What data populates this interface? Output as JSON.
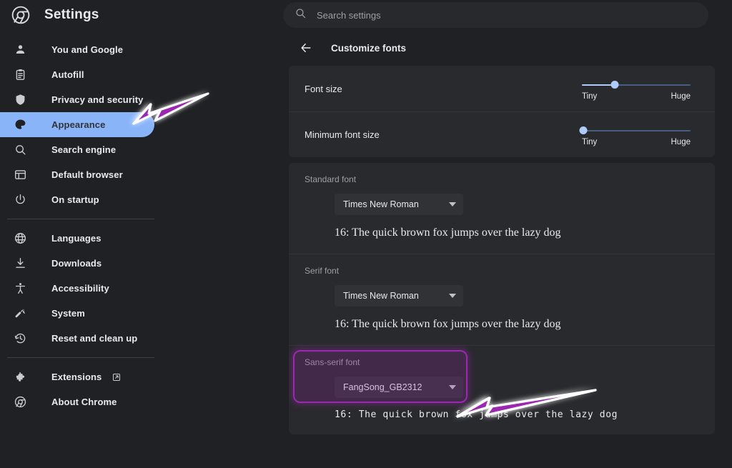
{
  "app": {
    "brand_title": "Settings",
    "logo_icon": "chrome-logo-icon"
  },
  "search": {
    "icon": "search-icon",
    "placeholder": "Search settings",
    "value": ""
  },
  "sidebar": {
    "items": [
      {
        "label": "You and Google",
        "icon": "person-icon",
        "active": false
      },
      {
        "label": "Autofill",
        "icon": "clipboard-icon",
        "active": false
      },
      {
        "label": "Privacy and security",
        "icon": "shield-icon",
        "active": false
      },
      {
        "label": "Appearance",
        "icon": "palette-icon",
        "active": true
      },
      {
        "label": "Search engine",
        "icon": "search-icon",
        "active": false
      },
      {
        "label": "Default browser",
        "icon": "browser-icon",
        "active": false
      },
      {
        "label": "On startup",
        "icon": "power-icon",
        "active": false
      },
      {
        "label": "Languages",
        "icon": "globe-icon",
        "active": false
      },
      {
        "label": "Downloads",
        "icon": "download-icon",
        "active": false
      },
      {
        "label": "Accessibility",
        "icon": "accessibility-icon",
        "active": false
      },
      {
        "label": "System",
        "icon": "wrench-icon",
        "active": false
      },
      {
        "label": "Reset and clean up",
        "icon": "history-icon",
        "active": false
      },
      {
        "label": "Extensions",
        "icon": "puzzle-icon",
        "active": false,
        "external": "external-link-icon"
      },
      {
        "label": "About Chrome",
        "icon": "chrome-logo-icon",
        "active": false
      }
    ]
  },
  "main": {
    "back_icon": "back-arrow-icon",
    "page_title": "Customize fonts",
    "sliders": [
      {
        "label": "Font size",
        "percent": 30,
        "min_label": "Tiny",
        "max_label": "Huge"
      },
      {
        "label": "Minimum font size",
        "percent": 1,
        "min_label": "Tiny",
        "max_label": "Huge"
      }
    ],
    "font_sections": [
      {
        "label": "Standard font",
        "selected": "Times New Roman",
        "caret_icon": "chevron-down-icon",
        "sample": "16: The quick brown fox jumps over the lazy dog",
        "sample_style": "serif",
        "highlighted": false
      },
      {
        "label": "Serif font",
        "selected": "Times New Roman",
        "caret_icon": "chevron-down-icon",
        "sample": "16: The quick brown fox jumps over the lazy dog",
        "sample_style": "serif",
        "highlighted": false
      },
      {
        "label": "Sans-serif font",
        "selected": "FangSong_GB2312",
        "caret_icon": "chevron-down-icon",
        "sample": "16: The quick brown fox jumps over the lazy dog",
        "sample_style": "mono",
        "highlighted": true
      }
    ]
  },
  "annotations": {
    "arrow_color": "#9c27b0",
    "outline_color": "#ffffff",
    "highlight_fill": "rgba(156,39,176,0.22)",
    "arrows": [
      {
        "name": "arrow-to-appearance",
        "target": "Appearance"
      },
      {
        "name": "arrow-to-sans-serif-dropdown",
        "target": "FangSong_GB2312"
      }
    ]
  },
  "theme": {
    "bg": "#202124",
    "card_bg": "#292a2d",
    "accent": "#8ab4f8",
    "text": "#e8eaed",
    "muted": "#9aa0a6"
  }
}
